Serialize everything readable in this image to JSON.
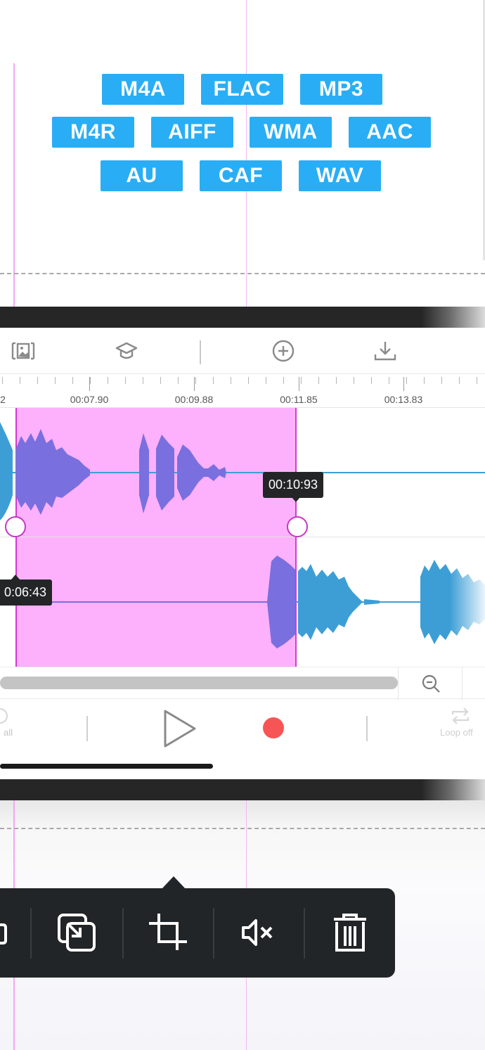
{
  "formats": {
    "row1": [
      "M4A",
      "FLAC",
      "MP3"
    ],
    "row2": [
      "M4R",
      "AIFF",
      "WMA",
      "AAC"
    ],
    "row3": [
      "AU",
      "CAF",
      "WAV"
    ]
  },
  "colors": {
    "badge": "#29aef5",
    "selection": "#fdb0fb",
    "selection_border": "#d13bd1",
    "waveform": "#3d9ed6",
    "waveform_selected": "#7a6fdf",
    "record": "#f75555",
    "context_bar": "#222527"
  },
  "toolbar": {
    "icons": [
      "image-frame-icon",
      "graduation-cap-icon",
      "add-circle-icon",
      "download-icon"
    ]
  },
  "ruler": {
    "labels": [
      "2",
      "00:07.90",
      "00:09.88",
      "00:11.85",
      "00:13.83"
    ]
  },
  "selection": {
    "start_label": "0:06:43",
    "end_label": "00:10:93"
  },
  "controls": {
    "left_label": "all",
    "right_label": "Loop off"
  },
  "context_menu": {
    "icons": [
      "partial-icon",
      "copy-icon",
      "crop-icon",
      "mute-icon",
      "trash-icon"
    ]
  }
}
